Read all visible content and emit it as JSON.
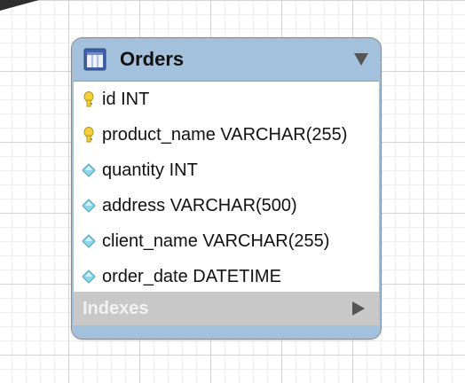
{
  "table": {
    "title": "Orders",
    "icon": "table-icon",
    "header_color": "#a3c0dc",
    "columns": [
      {
        "text": "id INT",
        "icon": "primary-key-icon"
      },
      {
        "text": "product_name VARCHAR(255)",
        "icon": "primary-key-icon"
      },
      {
        "text": "quantity INT",
        "icon": "column-diamond-icon"
      },
      {
        "text": "address VARCHAR(500)",
        "icon": "column-diamond-icon"
      },
      {
        "text": "client_name VARCHAR(255)",
        "icon": "column-diamond-icon"
      },
      {
        "text": "order_date DATETIME",
        "icon": "column-diamond-icon"
      }
    ],
    "indexes_label": "Indexes"
  }
}
